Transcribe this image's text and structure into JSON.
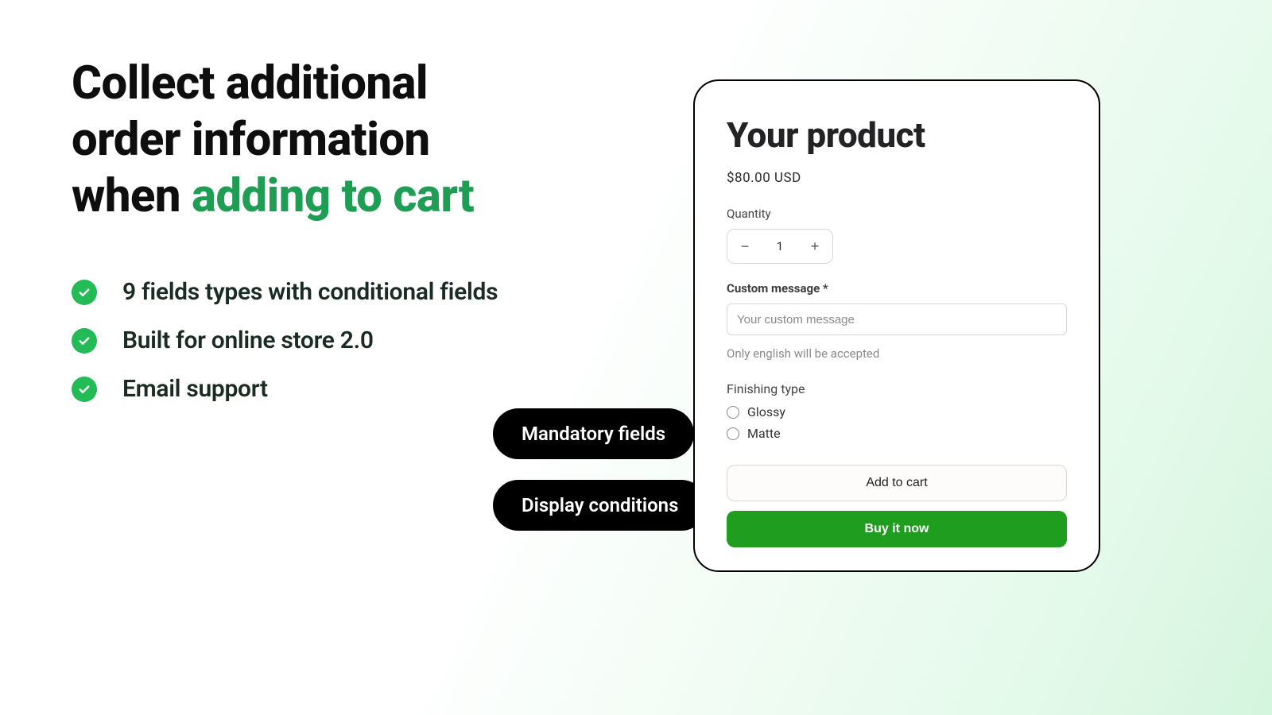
{
  "headline": {
    "line1": "Collect additional",
    "line2": "order information",
    "line3a": "when ",
    "line3b": "adding to cart"
  },
  "bullets": [
    "9 fields types with conditional fields",
    "Built for online store 2.0",
    "Email support"
  ],
  "pills": {
    "mandatory": "Mandatory fields",
    "conditions": "Display conditions"
  },
  "product": {
    "title": "Your product",
    "price": "$80.00 USD",
    "qty_label": "Quantity",
    "qty_value": "1",
    "custom_label": "Custom message *",
    "custom_placeholder": "Your custom message",
    "custom_helper": "Only english will be accepted",
    "finishing_label": "Finishing type",
    "finishing_options": [
      "Glossy",
      "Matte"
    ],
    "add_to_cart": "Add to cart",
    "buy_now": "Buy it now"
  }
}
